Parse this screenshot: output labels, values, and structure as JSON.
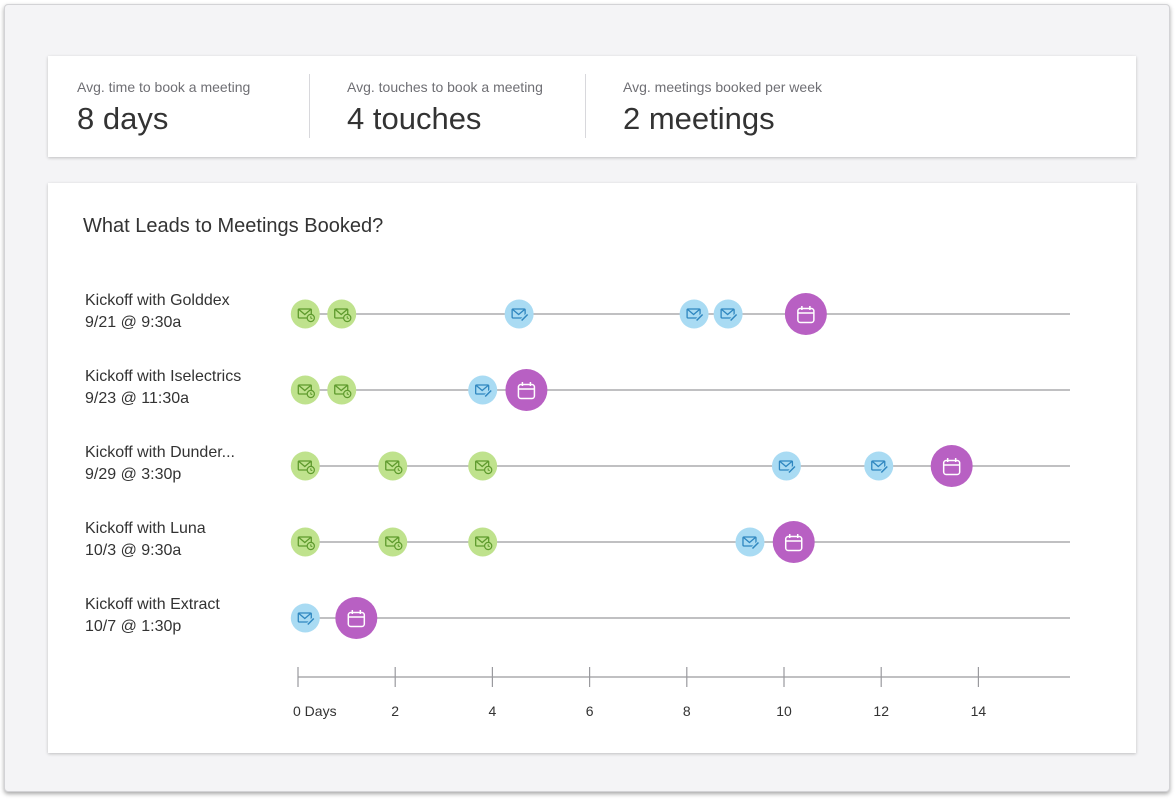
{
  "stats": [
    {
      "label": "Avg. time to book a meeting",
      "value": "8 days"
    },
    {
      "label": "Avg. touches to book a meeting",
      "value": "4 touches"
    },
    {
      "label": "Avg. meetings booked per week",
      "value": "2 meetings"
    }
  ],
  "timeline": {
    "title": "What Leads to Meetings Booked?",
    "colors": {
      "email_sent": "#bfe28d",
      "email_sent_icon": "#5e9a2d",
      "email_open": "#a9dbf3",
      "email_open_icon": "#2f87c0",
      "meeting": "#b860c3",
      "meeting_icon": "#ffffff",
      "line": "#9a9a9e"
    },
    "icons": {
      "email_sent": "envelope-clock-icon",
      "email_open": "envelope-pencil-icon",
      "meeting": "calendar-icon"
    },
    "rows": [
      {
        "name": "Kickoff with Golddex",
        "time": "9/21 @ 9:30a",
        "events": [
          {
            "day": 0.15,
            "type": "email_sent"
          },
          {
            "day": 0.9,
            "type": "email_sent"
          },
          {
            "day": 4.55,
            "type": "email_open"
          },
          {
            "day": 8.15,
            "type": "email_open"
          },
          {
            "day": 8.85,
            "type": "email_open"
          },
          {
            "day": 10.45,
            "type": "meeting"
          }
        ]
      },
      {
        "name": "Kickoff with Iselectrics",
        "time": "9/23 @ 11:30a",
        "events": [
          {
            "day": 0.15,
            "type": "email_sent"
          },
          {
            "day": 0.9,
            "type": "email_sent"
          },
          {
            "day": 3.8,
            "type": "email_open"
          },
          {
            "day": 4.7,
            "type": "meeting"
          }
        ]
      },
      {
        "name": "Kickoff with Dunder...",
        "time": "9/29 @ 3:30p",
        "events": [
          {
            "day": 0.15,
            "type": "email_sent"
          },
          {
            "day": 1.95,
            "type": "email_sent"
          },
          {
            "day": 3.8,
            "type": "email_sent"
          },
          {
            "day": 10.05,
            "type": "email_open"
          },
          {
            "day": 11.95,
            "type": "email_open"
          },
          {
            "day": 13.45,
            "type": "meeting"
          }
        ]
      },
      {
        "name": "Kickoff with Luna",
        "time": "10/3 @ 9:30a",
        "events": [
          {
            "day": 0.15,
            "type": "email_sent"
          },
          {
            "day": 1.95,
            "type": "email_sent"
          },
          {
            "day": 3.8,
            "type": "email_sent"
          },
          {
            "day": 9.3,
            "type": "email_open"
          },
          {
            "day": 10.2,
            "type": "meeting"
          }
        ]
      },
      {
        "name": "Kickoff with Extract",
        "time": "10/7 @ 1:30p",
        "events": [
          {
            "day": 0.15,
            "type": "email_open"
          },
          {
            "day": 1.2,
            "type": "meeting"
          }
        ]
      }
    ],
    "axis": {
      "tick_labels": [
        "0 Days",
        "2",
        "4",
        "6",
        "8",
        "10",
        "12",
        "14"
      ],
      "tick_values": [
        0,
        2,
        4,
        6,
        8,
        10,
        12,
        14
      ],
      "range": [
        0,
        16
      ]
    }
  }
}
